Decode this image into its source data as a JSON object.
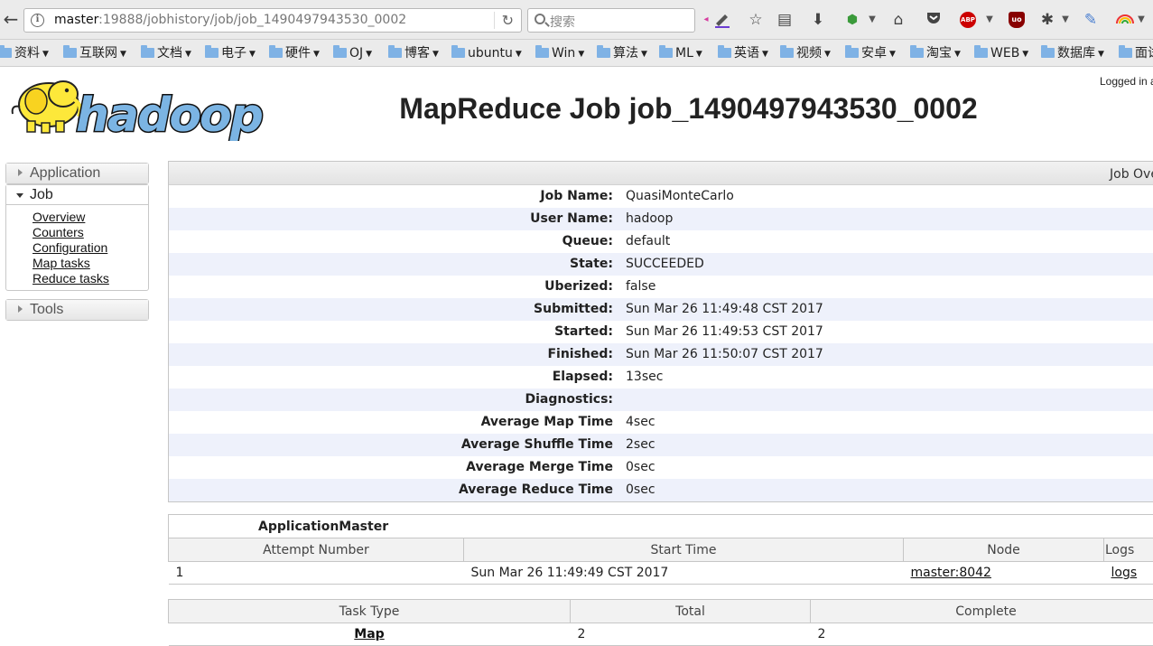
{
  "browser": {
    "url_host": "master",
    "url_rest": ":19888/jobhistory/job/job_1490497943530_0002",
    "search_placeholder": "搜索",
    "bookmarks": [
      {
        "label": "资料"
      },
      {
        "label": "互联网"
      },
      {
        "label": "文档"
      },
      {
        "label": "电子"
      },
      {
        "label": "硬件"
      },
      {
        "label": "OJ"
      },
      {
        "label": "博客"
      },
      {
        "label": "ubuntu"
      },
      {
        "label": "Win"
      },
      {
        "label": "算法"
      },
      {
        "label": "ML"
      },
      {
        "label": "英语"
      },
      {
        "label": "视频"
      },
      {
        "label": "安卓"
      },
      {
        "label": "淘宝"
      },
      {
        "label": "WEB"
      },
      {
        "label": "数据库"
      },
      {
        "label": "面试"
      }
    ],
    "toolbar_icons": [
      "highlighter-icon",
      "star-icon",
      "reader-icon",
      "download-icon",
      "extension-icon",
      "home-icon",
      "pocket-icon",
      "adblock-icon",
      "ublock-icon",
      "bug-icon",
      "note-icon",
      "rainbow-icon"
    ],
    "abp_label": "ABP",
    "ublock_label": "uo"
  },
  "header": {
    "title": "MapReduce Job job_1490497943530_0002",
    "logged_in": "Logged in as: dr.who"
  },
  "sidebar": {
    "application": "Application",
    "job": "Job",
    "job_links": [
      "Overview",
      "Counters",
      "Configuration",
      "Map tasks",
      "Reduce tasks"
    ],
    "tools": "Tools"
  },
  "overview": {
    "header": "Job Overview",
    "rows": [
      {
        "key": "Job Name:",
        "value": "QuasiMonteCarlo"
      },
      {
        "key": "User Name:",
        "value": "hadoop"
      },
      {
        "key": "Queue:",
        "value": "default"
      },
      {
        "key": "State:",
        "value": "SUCCEEDED"
      },
      {
        "key": "Uberized:",
        "value": "false"
      },
      {
        "key": "Submitted:",
        "value": "Sun Mar 26 11:49:48 CST 2017"
      },
      {
        "key": "Started:",
        "value": "Sun Mar 26 11:49:53 CST 2017"
      },
      {
        "key": "Finished:",
        "value": "Sun Mar 26 11:50:07 CST 2017"
      },
      {
        "key": "Elapsed:",
        "value": "13sec"
      },
      {
        "key": "Diagnostics:",
        "value": ""
      },
      {
        "key": "Average Map Time",
        "value": "4sec"
      },
      {
        "key": "Average Shuffle Time",
        "value": "2sec"
      },
      {
        "key": "Average Merge Time",
        "value": "0sec"
      },
      {
        "key": "Average Reduce Time",
        "value": "0sec"
      }
    ]
  },
  "am_table": {
    "caption": "ApplicationMaster",
    "headers": [
      "Attempt Number",
      "Start Time",
      "Node",
      "Logs"
    ],
    "row": {
      "attempt": "1",
      "start_time": "Sun Mar 26 11:49:49 CST 2017",
      "node": "master:8042",
      "logs": "logs"
    }
  },
  "task_table": {
    "headers": [
      "Task Type",
      "Total",
      "Complete"
    ],
    "row": {
      "type": "Map",
      "total": "2",
      "complete": "2"
    }
  }
}
